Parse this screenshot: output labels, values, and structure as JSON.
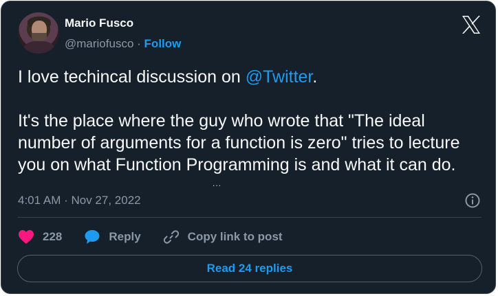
{
  "author": {
    "name": "Mario Fusco",
    "handle": "@mariofusco",
    "separator": "·",
    "follow_label": "Follow"
  },
  "tweet": {
    "line1_before": "I love techincal discussion on ",
    "line1_mention": "@Twitter",
    "line1_after": ".",
    "paragraph2": "It's the place where the guy who wrote that \"The ideal number of arguments for a function is zero\" tries to lecture you on what Function Programming is and what it can do.",
    "truncation": "..."
  },
  "meta": {
    "timestamp": "4:01 AM · Nov 27, 2022"
  },
  "actions": {
    "like_count": "228",
    "reply_label": "Reply",
    "copy_label": "Copy link to post"
  },
  "read_replies_label": "Read 24 replies",
  "icons": {
    "platform_logo": "x-logo-icon",
    "like": "heart-icon",
    "reply": "speech-bubble-icon",
    "copy": "link-icon",
    "info": "info-icon"
  },
  "colors": {
    "background": "#15202b",
    "accent": "#1d9bf0",
    "like": "#f91880",
    "muted_text": "#8b98a5"
  }
}
